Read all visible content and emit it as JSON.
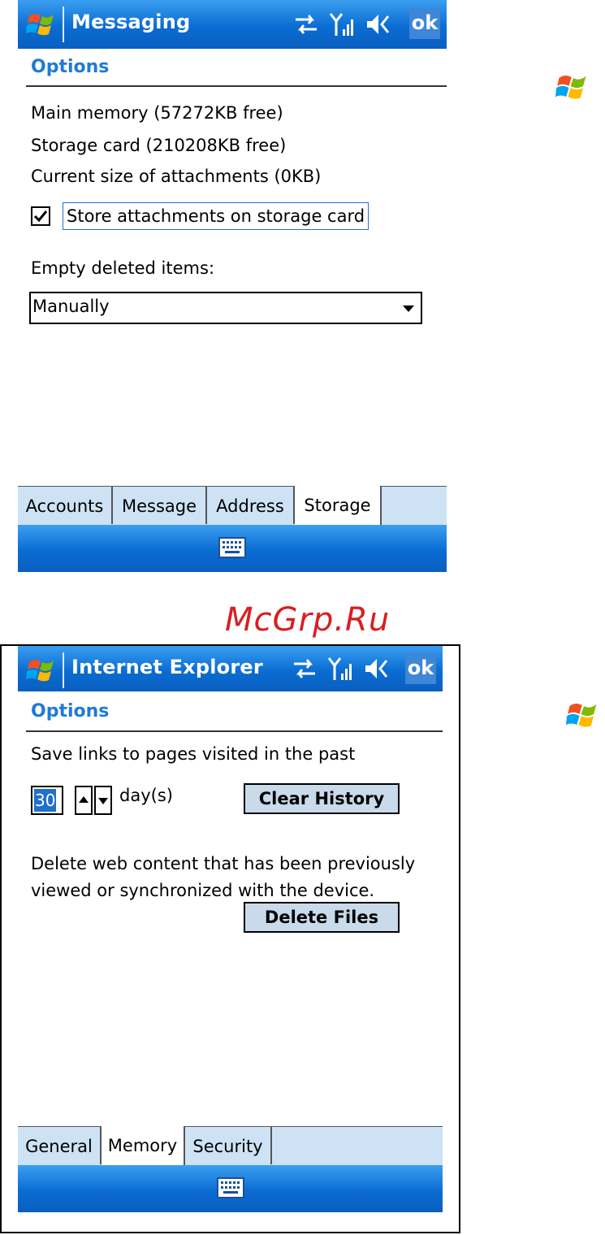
{
  "screen1": {
    "title": "Messaging",
    "ok_label": "ok",
    "heading": "Options",
    "lines": [
      "Main memory (57272KB free)",
      "Storage card (210208KB free)",
      "Current size of attachments (0KB)"
    ],
    "checkbox_label": "Store attachments on storage card",
    "checkbox_checked": true,
    "empty_label": "Empty deleted items:",
    "empty_value": "Manually",
    "tabs": [
      "Accounts",
      "Message",
      "Address",
      "Storage"
    ],
    "active_tab": "Storage"
  },
  "brand_watermark": "McGrp.Ru",
  "screen2": {
    "title": "Internet Explorer",
    "ok_label": "ok",
    "heading": "Options",
    "save_links_text": "Save links to pages visited in the past",
    "days_value": "30",
    "days_unit": "day(s)",
    "clear_history_label": "Clear History",
    "delete_text_line1": "Delete web content that has been previously",
    "delete_text_line2": "viewed or synchronized with the device.",
    "delete_files_label": "Delete Files",
    "tabs": [
      "General",
      "Memory",
      "Security"
    ],
    "active_tab": "Memory"
  },
  "colors": {
    "titlebar_blue": "#0b6cd2",
    "heading_blue": "#1f7ad6",
    "tab_bg": "#cde2f5",
    "button_bg": "#c9dbeb",
    "watermark_red": "#d81e22"
  },
  "icons": [
    "windows-flag-icon",
    "sync-arrows-icon",
    "signal-icon",
    "speaker-icon",
    "keyboard-icon"
  ]
}
